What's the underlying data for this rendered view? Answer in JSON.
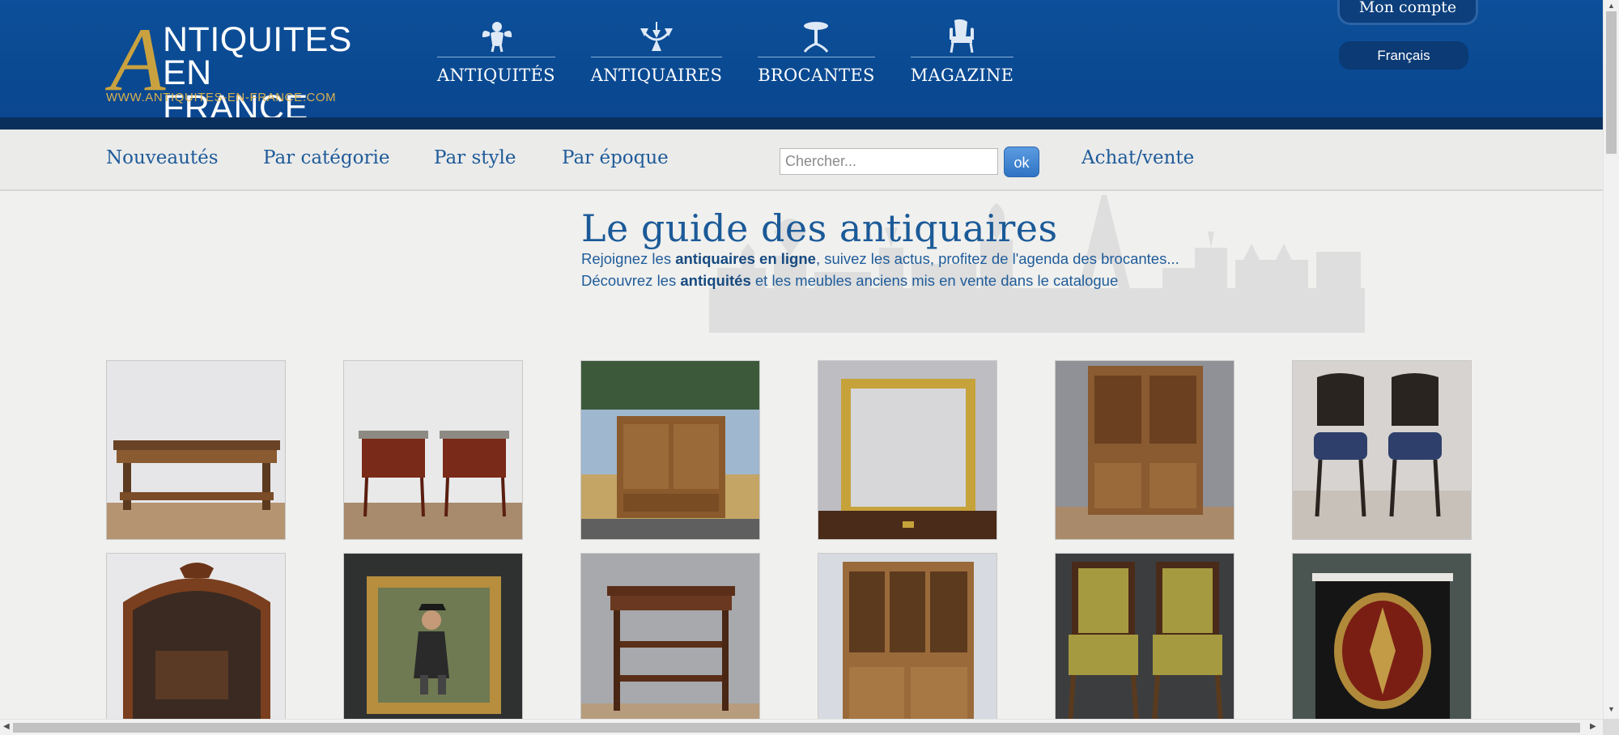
{
  "logo": {
    "big_letter": "A",
    "line1": "NTIQUITES",
    "line2": "EN FRANCE",
    "url": "WWW.ANTIQUITES-EN-FRANCE.COM"
  },
  "main_nav": [
    {
      "label": "ANTIQUITÉS",
      "icon": "cherub-icon"
    },
    {
      "label": "ANTIQUAIRES",
      "icon": "chandelier-icon"
    },
    {
      "label": "BROCANTES",
      "icon": "gueridon-table-icon"
    },
    {
      "label": "MAGAZINE",
      "icon": "armchair-icon"
    }
  ],
  "account": {
    "label": "Mon compte"
  },
  "language": {
    "label": "Français"
  },
  "sub_nav": {
    "nouveautes": "Nouveautés",
    "par_categorie": "Par catégorie",
    "par_style": "Par style",
    "par_epoque": "Par époque",
    "achat_vente": "Achat/vente"
  },
  "search": {
    "placeholder": "Chercher...",
    "value": "",
    "button_label": "ok"
  },
  "page": {
    "title": "Le guide des antiquaires",
    "intro1": {
      "pre": "Rejoignez les ",
      "bold": "antiquaires en ligne",
      "post": ", suivez les actus, profitez de l'agenda des brocantes..."
    },
    "intro2": {
      "pre": "Découvrez les ",
      "bold": "antiquités",
      "post": " et les meubles anciens mis en vente dans le catalogue"
    }
  },
  "products": [
    {
      "name": "console-table-thumbnail"
    },
    {
      "name": "pair-of-nightstands-thumbnail"
    },
    {
      "name": "farmhouse-cabinet-thumbnail"
    },
    {
      "name": "gilt-mirror-thumbnail"
    },
    {
      "name": "bookcase-buffet-thumbnail"
    },
    {
      "name": "pair-of-carved-chairs-thumbnail"
    },
    {
      "name": "mantel-mirror-thumbnail"
    },
    {
      "name": "framed-painting-thumbnail"
    },
    {
      "name": "serving-etagere-thumbnail"
    },
    {
      "name": "glazed-bookcase-thumbnail"
    },
    {
      "name": "pair-of-armchairs-thumbnail"
    },
    {
      "name": "boulle-cabinet-thumbnail"
    }
  ],
  "colors": {
    "header_blue": "#0b4a92",
    "link_blue": "#1e5b99",
    "gold": "#c9a23f"
  }
}
